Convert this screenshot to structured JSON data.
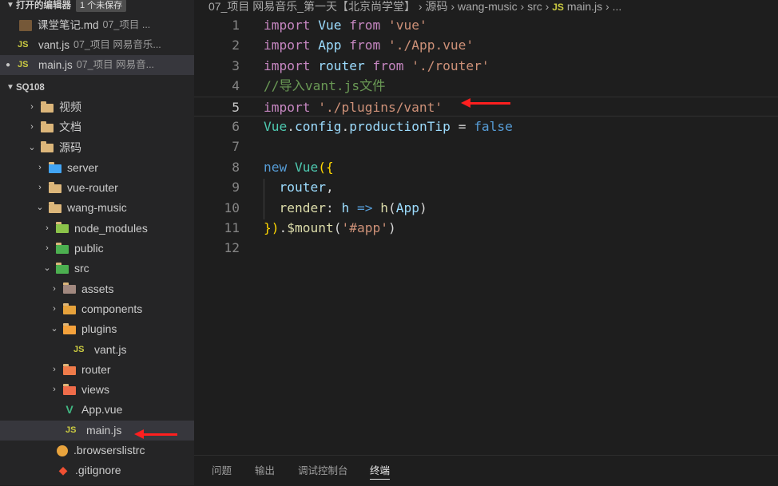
{
  "explorer": {
    "open_editors_header": "打开的编辑器",
    "unsaved_badge": "1 个未保存",
    "open_editors": [
      {
        "icon": "markdown-icon",
        "name": "课堂笔记.md",
        "path": "07_项目 ..."
      },
      {
        "icon": "js-icon",
        "name": "vant.js",
        "path": "07_项目 网易音乐..."
      },
      {
        "icon": "js-icon",
        "name": "main.js",
        "path": "07_项目 网易音..."
      }
    ],
    "workspace_header": "SQ108",
    "tree": {
      "shipin": "视频",
      "wendang": "文档",
      "yuanma": "源码",
      "server": "server",
      "vue_router": "vue-router",
      "wang_music": "wang-music",
      "node_modules": "node_modules",
      "public": "public",
      "src": "src",
      "assets": "assets",
      "components": "components",
      "plugins": "plugins",
      "vant_js": "vant.js",
      "router": "router",
      "views": "views",
      "app_vue": "App.vue",
      "main_js": "main.js",
      "browserslistrc": ".browserslistrc",
      "gitignore": ".gitignore"
    }
  },
  "breadcrumb": {
    "parts": [
      "07_项目 网易音乐_第一天【北京尚学堂】",
      "源码",
      "wang-music",
      "src"
    ],
    "js_label": "JS",
    "file": "main.js",
    "ellipsis": "..."
  },
  "editor": {
    "line_numbers": [
      "1",
      "2",
      "3",
      "4",
      "5",
      "6",
      "7",
      "8",
      "9",
      "10",
      "11",
      "12"
    ],
    "current_line": 5,
    "tokens": {
      "import": "import",
      "from": "from",
      "vue_id": "Vue",
      "vue_str": "'vue'",
      "app_id": "App",
      "app_str": "'./App.vue'",
      "router_id": "router",
      "router_str": "'./router'",
      "comment": "//导入vant.js文件",
      "vant_str": "'./plugins/vant'",
      "config": "config",
      "productionTip": "productionTip",
      "eq": "=",
      "false_kw": "false",
      "new_kw": "new",
      "open": "({",
      "router_prop": "router",
      "comma": ",",
      "render": "render",
      "colon": ":",
      "h": "h",
      "arrow": "=>",
      "lp": "(",
      "rp": ")",
      "close": "})",
      "dot": ".",
      "mount": "$mount",
      "app_sel": "'#app'"
    }
  },
  "panel": {
    "tabs": [
      "问题",
      "输出",
      "调试控制台",
      "终端"
    ],
    "active_tab": "终端"
  },
  "colors": {
    "annotation_arrow": "#ff1f1f",
    "keyword": "#c586c0",
    "string": "#ce9178",
    "variable": "#9cdcfe",
    "comment": "#6a9955"
  }
}
